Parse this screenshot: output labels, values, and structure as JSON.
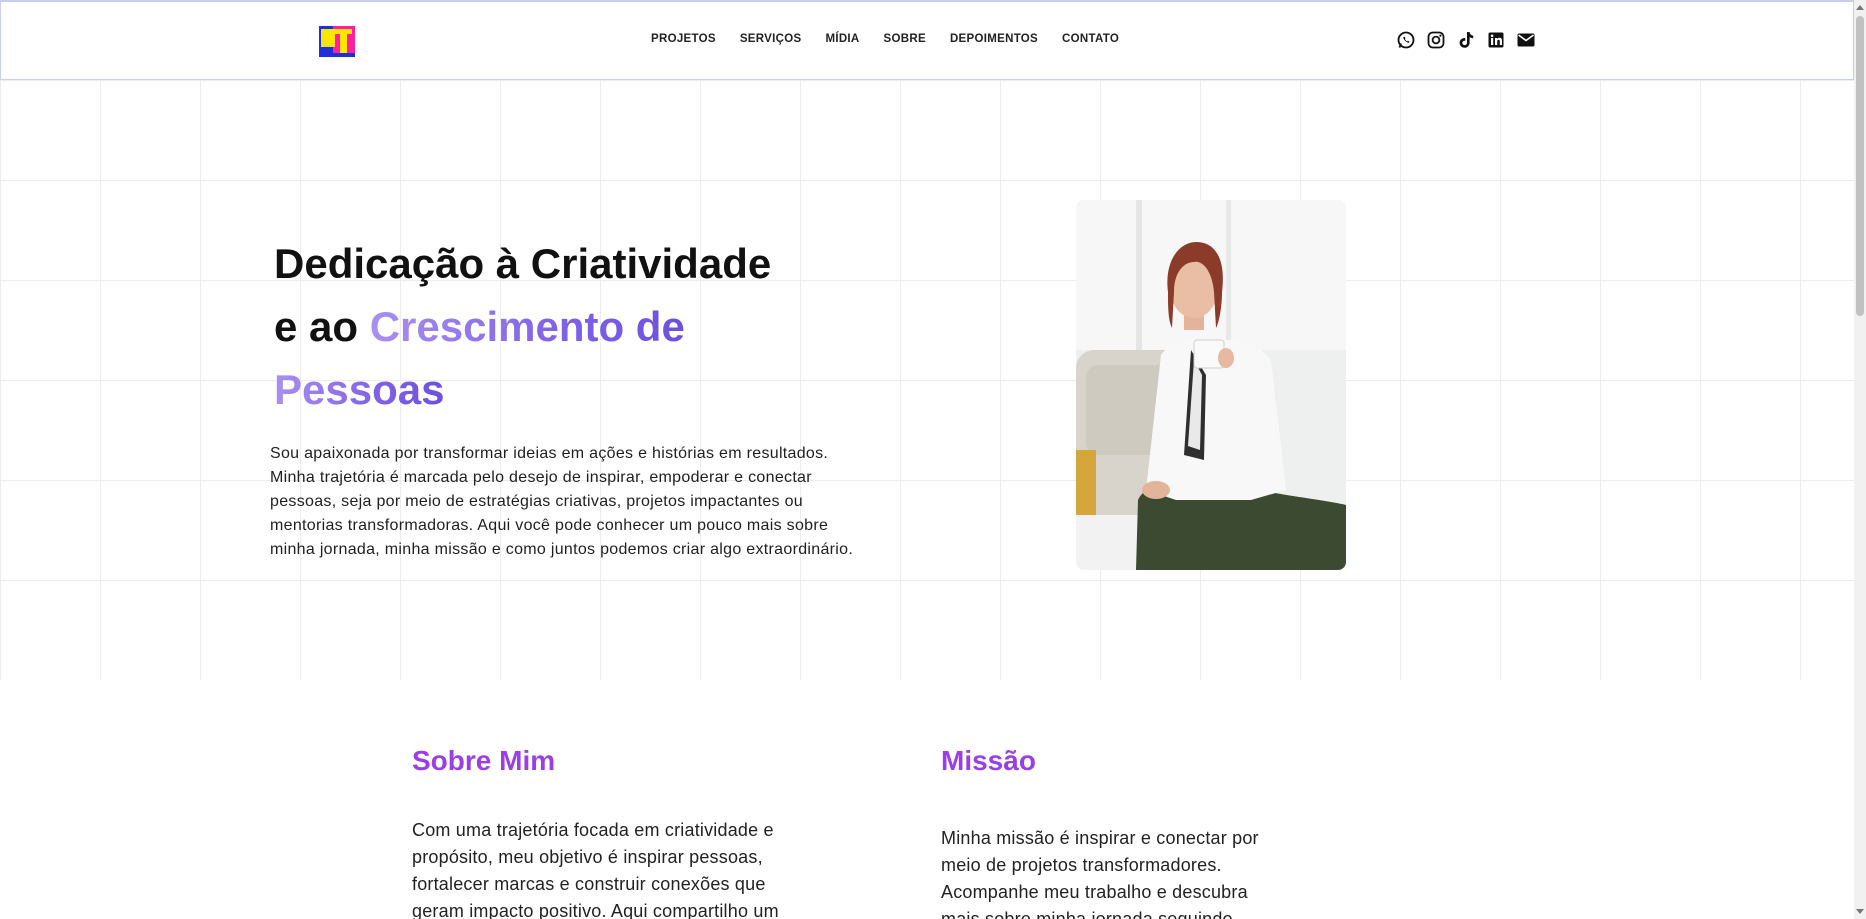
{
  "header": {
    "nav": [
      "PROJETOS",
      "SERVIÇOS",
      "MÍDIA",
      "SOBRE",
      "DEPOIMENTOS",
      "CONTATO"
    ],
    "socials": [
      "whatsapp-icon",
      "instagram-icon",
      "tiktok-icon",
      "linkedin-icon",
      "email-icon"
    ]
  },
  "hero": {
    "title_line1": "Dedicação à Criatividade",
    "title_line2_prefix": "e ao ",
    "title_accent_1": "Crescimento de",
    "title_accent_2": "Pessoas",
    "paragraph": "Sou apaixonada por transformar ideias em ações e histórias em resultados. Minha trajetória é marcada pelo desejo de inspirar, empoderar e conectar pessoas, seja por meio de estratégias criativas, projetos impactantes ou mentorias transformadoras. Aqui você pode conhecer um pouco mais sobre minha jornada, minha missão e como juntos podemos criar algo extraordinário."
  },
  "about": {
    "heading": "Sobre Mim",
    "text": "Com uma trajetória focada em criatividade e propósito, meu objetivo é inspirar pessoas, fortalecer marcas e construir conexões que geram impacto positivo. Aqui compartilho um"
  },
  "mission": {
    "heading": "Missão",
    "text": "Minha missão é inspirar e conectar por meio de projetos transformadores. Acompanhe meu trabalho e descubra mais sobre minha jornada seguindo"
  },
  "colors": {
    "accent_purple": "#8062e6",
    "heading_purple": "#9b3ee6",
    "header_border": "#c9cdef"
  }
}
